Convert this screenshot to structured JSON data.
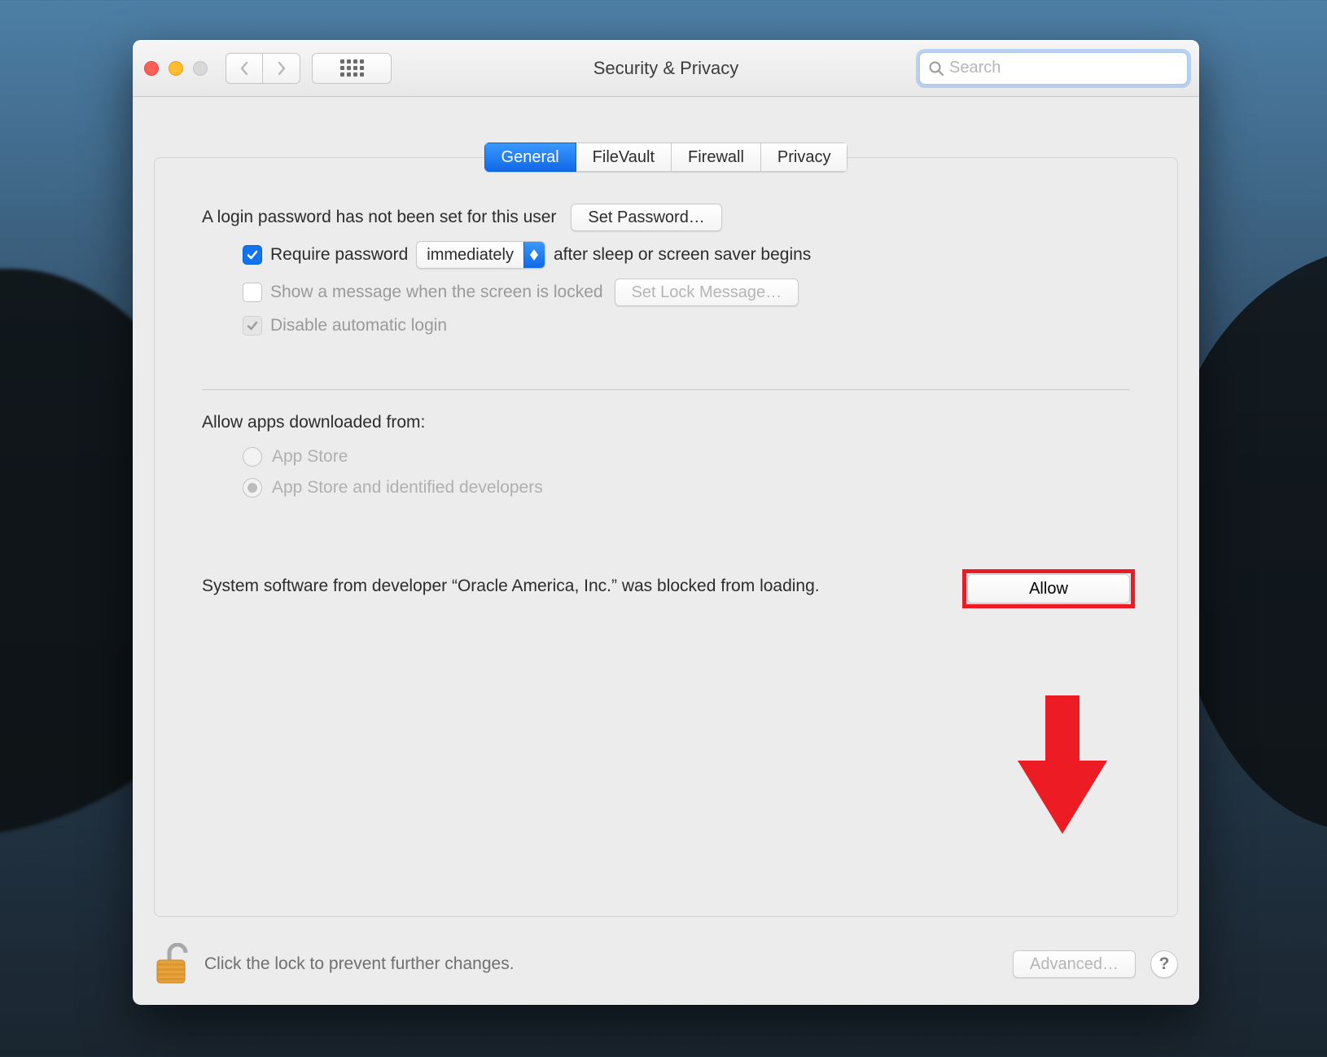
{
  "window": {
    "title": "Security & Privacy",
    "search_placeholder": "Search"
  },
  "tabs": {
    "general": "General",
    "filevault": "FileVault",
    "firewall": "Firewall",
    "privacy": "Privacy"
  },
  "login": {
    "no_password_msg": "A login password has not been set for this user",
    "set_password_btn": "Set Password…",
    "require_password_label": "Require password",
    "require_password_select": "immediately",
    "after_sleep_label": "after sleep or screen saver begins",
    "show_message_label": "Show a message when the screen is locked",
    "set_lock_message_btn": "Set Lock Message…",
    "disable_auto_login_label": "Disable automatic login"
  },
  "allow_apps": {
    "heading": "Allow apps downloaded from:",
    "app_store": "App Store",
    "app_store_identified": "App Store and identified developers"
  },
  "blocked": {
    "message": "System software from developer “Oracle America, Inc.” was blocked from loading.",
    "allow_btn": "Allow"
  },
  "footer": {
    "lock_hint": "Click the lock to prevent further changes.",
    "advanced_btn": "Advanced…",
    "help_btn": "?"
  }
}
